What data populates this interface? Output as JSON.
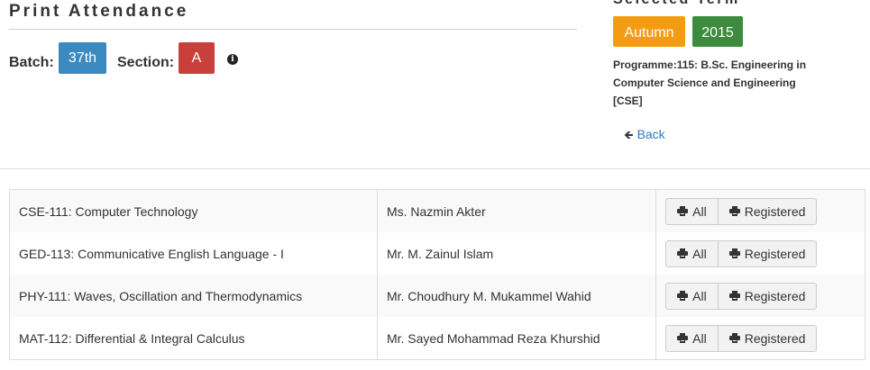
{
  "page": {
    "title": "Print Attendance"
  },
  "batch": {
    "label": "Batch:",
    "value": "37th",
    "section_label": "Section:",
    "section_value": "A",
    "info_icon": "info-circle-icon"
  },
  "term": {
    "title": "Selected Term",
    "season": "Autumn",
    "year": "2015",
    "programme": "Programme:115: B.Sc. Engineering in Computer Science and Engineering [CSE]"
  },
  "back": {
    "label": "Back",
    "icon": "arrow-left-icon"
  },
  "colors": {
    "batch_pill": "#3a8abf",
    "section_pill": "#c9403a",
    "season_pill": "#f39c12",
    "year_pill": "#3d8b3d",
    "link": "#2a7bbf"
  },
  "courses": [
    {
      "course": "CSE-111: Computer Technology",
      "teacher": "Ms. Nazmin Akter",
      "all_label": "All",
      "registered_label": "Registered"
    },
    {
      "course": "GED-113: Communicative English Language - I",
      "teacher": "Mr. M. Zainul Islam",
      "all_label": "All",
      "registered_label": "Registered"
    },
    {
      "course": "PHY-111: Waves, Oscillation and Thermodynamics",
      "teacher": "Mr. Choudhury M. Mukammel Wahid",
      "all_label": "All",
      "registered_label": "Registered"
    },
    {
      "course": "MAT-112: Differential & Integral Calculus",
      "teacher": "Mr. Sayed Mohammad Reza Khurshid",
      "all_label": "All",
      "registered_label": "Registered"
    }
  ]
}
